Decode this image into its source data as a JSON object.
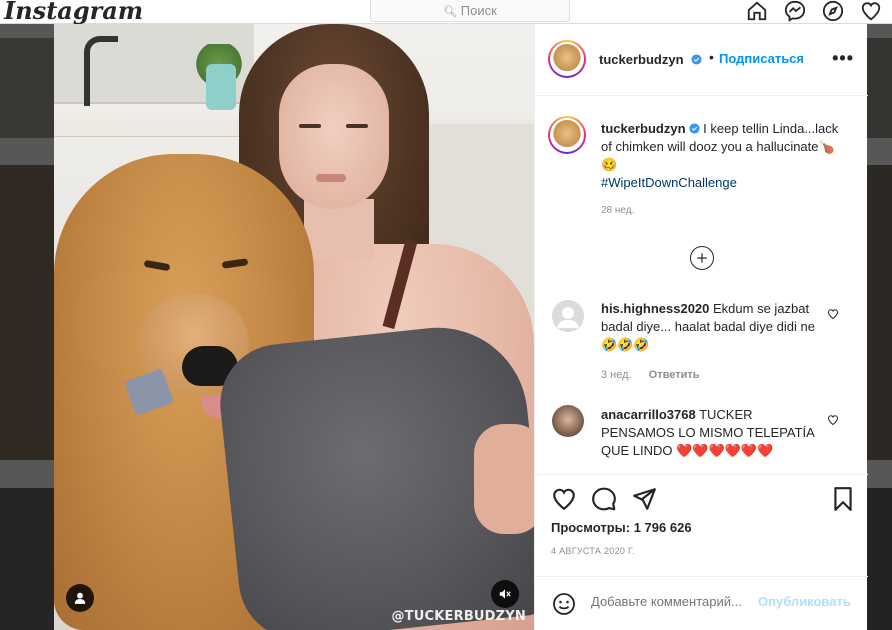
{
  "app": {
    "logo": "Instagram",
    "search_placeholder": "Поиск"
  },
  "nav_icons": [
    "home-icon",
    "messenger-icon",
    "explore-icon",
    "heart-icon"
  ],
  "post": {
    "username": "tuckerbudzyn",
    "follow_label": "Подписаться",
    "more_label": "•••",
    "video_watermark": "@TUCKERBUDZYN",
    "caption": {
      "username": "tuckerbudzyn",
      "text": "I keep tellin Linda...lack of chimken will dooz you a hallucinate🍗🥴",
      "hashtag": "#WipeItDownChallenge",
      "time": "28 нед."
    },
    "comments": [
      {
        "username": "his.highness2020",
        "text": "Ekdum se jazbat badal diye... haalat badal diye didi ne🤣🤣🤣",
        "time": "3 нед.",
        "reply_label": "Ответить"
      },
      {
        "username": "anacarrillo3768",
        "text": "TUCKER PENSAMOS LO MISMO TELEPATÍA QUE LINDO ❤️❤️❤️❤️❤️❤️"
      }
    ],
    "views_label": "Просмотры:",
    "views_count": "1 796 626",
    "date": "4 АВГУСТА 2020 Г.",
    "comment_placeholder": "Добавьте комментарий...",
    "post_button": "Опубликовать"
  },
  "colors": {
    "accent": "#0095f6",
    "hashtag": "#00376b",
    "muted": "#8e8e8e",
    "heart_red": "#ed4956"
  }
}
